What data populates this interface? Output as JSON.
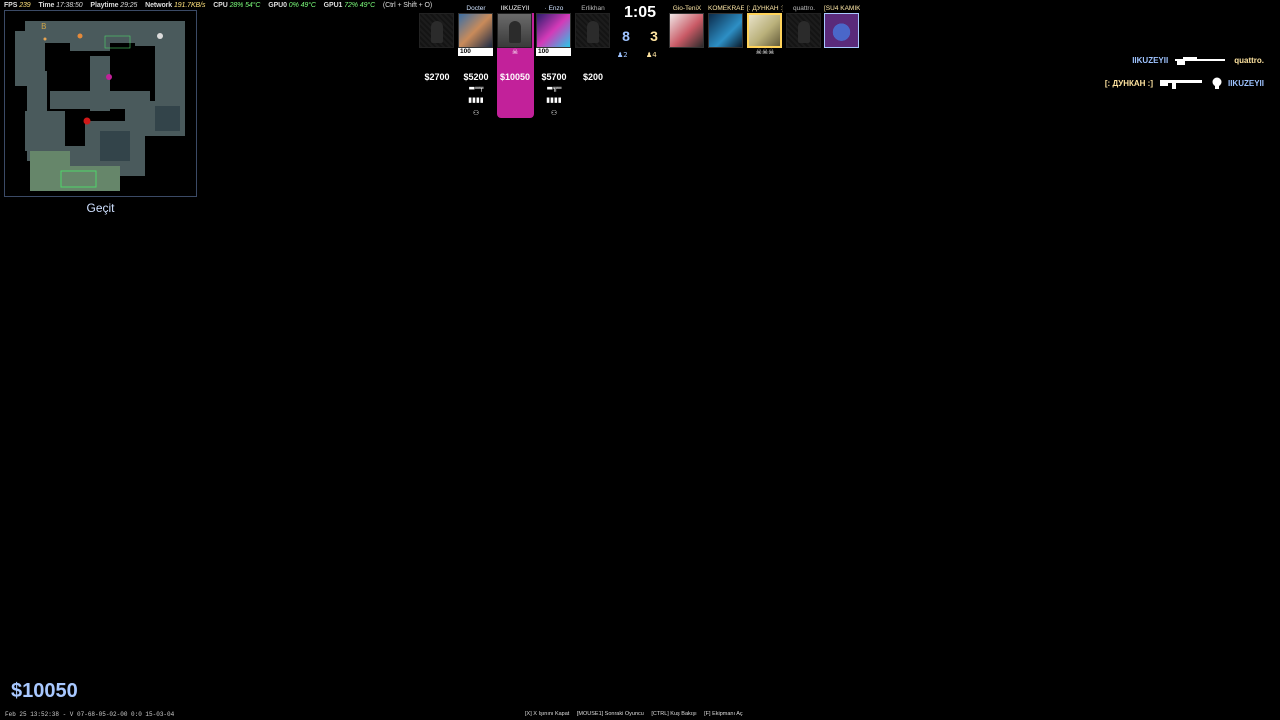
{
  "perf": {
    "fps_label": "FPS",
    "fps": "239",
    "time_label": "Time",
    "time": "17:38:50",
    "playtime_label": "Playtime",
    "playtime": "29:25",
    "network_label": "Network",
    "network": "191.7KB/s",
    "cpu_label": "CPU",
    "cpu_load": "28%",
    "cpu_temp": "54°C",
    "gpu0_label": "GPU0",
    "gpu0_load": "0%",
    "gpu0_temp": "49°C",
    "gpu1_label": "GPU1",
    "gpu1_load": "72%",
    "gpu1_temp": "49°C",
    "shortcut": "(Ctrl + Shift + O)"
  },
  "radar": {
    "map_name": "Geçit"
  },
  "scoreboard": {
    "clock": "1:05",
    "ct_score": "8",
    "t_score": "3",
    "ct_alive": "♟2",
    "t_alive": "♟4",
    "left_team": [
      {
        "name": "",
        "money": "$2700",
        "hp": "",
        "dead": true
      },
      {
        "name": "Docter",
        "money": "$5200",
        "hp": "100",
        "dead": false
      },
      {
        "name": "IIKUZEYII",
        "money": "$10050",
        "hp": "",
        "dead": true,
        "spectated": true
      },
      {
        "name": "· Enzo",
        "money": "$5700",
        "hp": "100",
        "dead": false
      },
      {
        "name": "Erlikhan",
        "money": "$200",
        "hp": "",
        "dead": true
      }
    ],
    "right_team": [
      {
        "name": "Gio-TeniX",
        "dead": false
      },
      {
        "name": "KOMEKRAEN",
        "dead": false
      },
      {
        "name": "[: ДУНКАН :]",
        "dead": false
      },
      {
        "name": "quattro.",
        "dead": true
      },
      {
        "name": "[SU4 KAMIK",
        "dead": false
      }
    ],
    "left_weapons": [
      "▬═╤",
      "▬╦═"
    ],
    "left_utils": [
      "▮▮▮▮",
      "▮▮▮▮"
    ],
    "left_defuse": [
      "⚇",
      "⚇"
    ]
  },
  "killfeed": [
    {
      "killer": "IIKUZEYII",
      "killer_side": "ct",
      "weapon_icon": "awp-icon",
      "victim": "quattro.",
      "victim_side": "t"
    },
    {
      "killer": "[: ДУНКАН :]",
      "killer_side": "t",
      "weapon_icon": "ak47-icon",
      "victim": "IIKUZEYII",
      "victim_side": "ct"
    }
  ],
  "player_money": "$10050",
  "demo_info": "Feb 25 13:52:38 - V 07-68-05-02-00 0:0 15-03-04",
  "hints": [
    "[X] X Işınını Kapat",
    "[MOUSE1] Sonraki Oyuncu",
    "[CTRL] Kuş Bakışı",
    "[F] Ekipmanı Aç"
  ],
  "colors": {
    "ct": "#9ec3ff",
    "t": "#ffe4a0",
    "spectated": "#c2219a"
  }
}
